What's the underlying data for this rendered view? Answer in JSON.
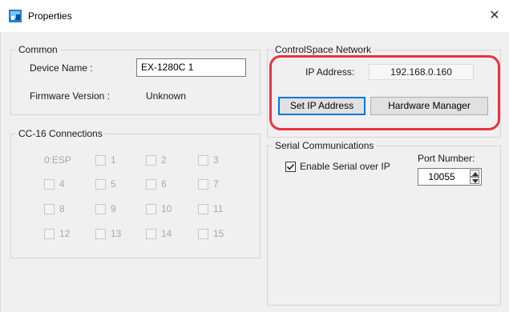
{
  "window": {
    "title": "Properties",
    "close_glyph": "✕",
    "icon": "app-icon"
  },
  "common": {
    "legend": "Common",
    "device_name_label": "Device Name :",
    "device_name_value": "EX-1280C 1",
    "firmware_label": "Firmware Version :",
    "firmware_value": "Unknown"
  },
  "cc16": {
    "legend": "CC-16 Connections",
    "first_label": "0:ESP",
    "items": [
      "1",
      "2",
      "3",
      "4",
      "5",
      "6",
      "7",
      "8",
      "9",
      "10",
      "11",
      "12",
      "13",
      "14",
      "15"
    ]
  },
  "network": {
    "legend": "ControlSpace Network",
    "ip_label": "IP Address:",
    "ip_value": "192.168.0.160",
    "set_ip_button": "Set IP Address",
    "hardware_manager_button": "Hardware Manager"
  },
  "serial": {
    "legend": "Serial Communications",
    "enable_label": "Enable Serial over IP",
    "enable_checked": true,
    "port_label": "Port Number:",
    "port_value": "10055"
  },
  "colors": {
    "highlight": "#e8333d",
    "focus_border": "#0078d7",
    "disabled_text": "#a8a8a8"
  }
}
